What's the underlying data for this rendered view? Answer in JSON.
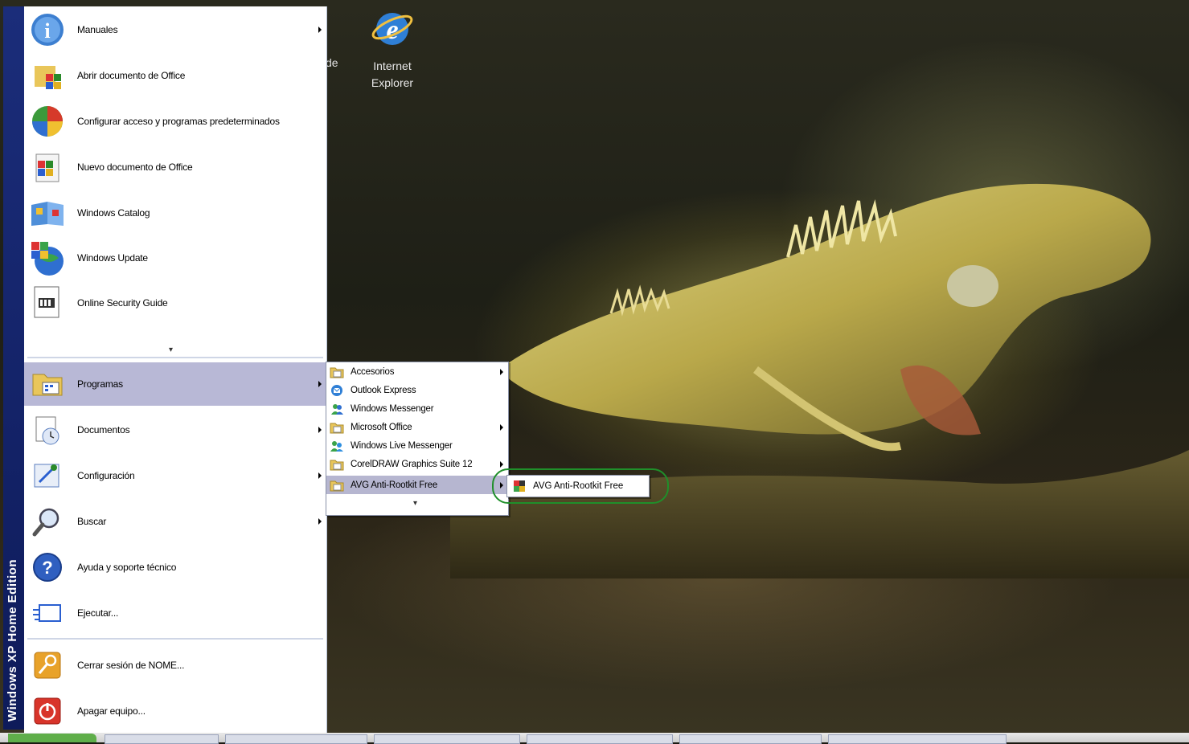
{
  "desktop": {
    "icon_label_line1": "Internet",
    "icon_label_line2": "Explorer",
    "partial_label": "de"
  },
  "sidebar": {
    "edition_text": "Windows XP Home Edition"
  },
  "start_menu": {
    "pinned": [
      {
        "label": "Manuales",
        "icon": "info-icon",
        "has_submenu": true
      },
      {
        "label": "Abrir documento de Office",
        "icon": "office-open-icon",
        "has_submenu": false
      },
      {
        "label": "Configurar acceso y programas predeterminados",
        "icon": "default-programs-icon",
        "has_submenu": false
      },
      {
        "label": "Nuevo documento de Office",
        "icon": "office-new-icon",
        "has_submenu": false
      },
      {
        "label": "Windows Catalog",
        "icon": "windows-catalog-icon",
        "has_submenu": false
      },
      {
        "label": "Windows Update",
        "icon": "windows-update-icon",
        "has_submenu": false
      },
      {
        "label": "Online Security Guide",
        "icon": "security-guide-icon",
        "has_submenu": false
      }
    ],
    "main": [
      {
        "label": "Programas",
        "icon": "programs-icon",
        "has_submenu": true
      },
      {
        "label": "Documentos",
        "icon": "documents-icon",
        "has_submenu": true
      },
      {
        "label": "Configuración",
        "icon": "settings-icon",
        "has_submenu": true
      },
      {
        "label": "Buscar",
        "icon": "search-icon",
        "has_submenu": true
      },
      {
        "label": "Ayuda y soporte técnico",
        "icon": "help-icon",
        "has_submenu": false
      },
      {
        "label": "Ejecutar...",
        "icon": "run-icon",
        "has_submenu": false
      }
    ],
    "footer": [
      {
        "label": "Cerrar sesión de NOME...",
        "icon": "logoff-icon"
      },
      {
        "label": "Apagar equipo...",
        "icon": "shutdown-icon"
      }
    ]
  },
  "programs_submenu": [
    {
      "label": "Accesorios",
      "icon": "folder-icon",
      "has_submenu": true
    },
    {
      "label": "Outlook Express",
      "icon": "outlook-icon",
      "has_submenu": false
    },
    {
      "label": "Windows Messenger",
      "icon": "messenger-icon",
      "has_submenu": false
    },
    {
      "label": "Microsoft Office",
      "icon": "folder-icon",
      "has_submenu": true
    },
    {
      "label": "Windows Live Messenger",
      "icon": "live-messenger-icon",
      "has_submenu": false
    },
    {
      "label": "CorelDRAW Graphics Suite 12",
      "icon": "folder-icon",
      "has_submenu": true
    },
    {
      "label": "AVG Anti-Rootkit Free",
      "icon": "folder-icon",
      "has_submenu": true
    }
  ],
  "avg_submenu": {
    "label": "AVG Anti-Rootkit Free",
    "icon": "avg-icon"
  },
  "colors": {
    "menu_highlight": "#b8b8d6",
    "sidebar_blue": "#1b2d7a",
    "annotation_green": "#1f8f2a"
  }
}
